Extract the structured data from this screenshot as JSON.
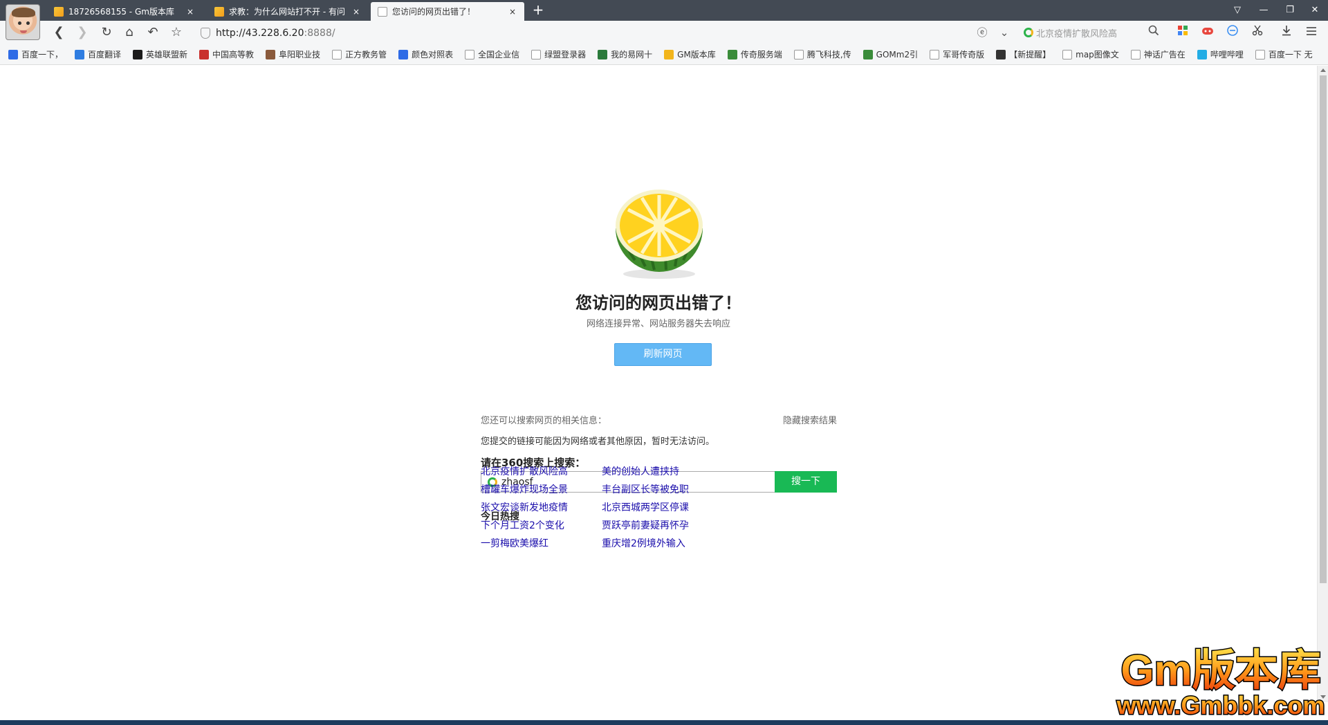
{
  "tabs": [
    {
      "title": "18726568155 - Gm版本库",
      "close": "×"
    },
    {
      "title": "求教：为什么网站打不开 - 有问",
      "close": "×"
    },
    {
      "title": "您访问的网页出错了！",
      "close": "×"
    }
  ],
  "newtab_label": "+",
  "window_controls": {
    "menu": "▽",
    "minimize": "—",
    "restore": "❐",
    "close": "✕"
  },
  "navigation": {
    "back": "❮",
    "forward": "❯",
    "reload": "↻",
    "home": "⌂",
    "undo": "↶",
    "star": "☆"
  },
  "address": {
    "host": "http://43.228.6.20",
    "rest": ":8888/"
  },
  "address_tools": {
    "compat": "ⓔ",
    "dropdown": "⌄"
  },
  "search_box": {
    "placeholder": "北京疫情扩散风险高",
    "icon": "search-icon"
  },
  "toolbar_icons": [
    "apps-icon",
    "game-icon",
    "translate-icon",
    "scissors-icon",
    "download-icon",
    "menu-icon"
  ],
  "bookmarks": [
    {
      "label": "百度一下，",
      "color": "#2e6be6"
    },
    {
      "label": "百度翻译",
      "color": "#2f7de1"
    },
    {
      "label": "英雄联盟新",
      "color": "#1b1b1b"
    },
    {
      "label": "中国高等教",
      "color": "#c9302c"
    },
    {
      "label": "阜阳职业技",
      "color": "#8a5a3c"
    },
    {
      "label": "正方教务管",
      "color": "#ffffff"
    },
    {
      "label": "颜色对照表",
      "color": "#2e6be6"
    },
    {
      "label": "全国企业信",
      "color": "#ffffff"
    },
    {
      "label": "绿盟登录器",
      "color": "#ffffff"
    },
    {
      "label": "我的易网十",
      "color": "#2a7a3b"
    },
    {
      "label": "GM版本库",
      "color": "#f2b51c"
    },
    {
      "label": "传奇服务端",
      "color": "#3a8c3a"
    },
    {
      "label": "腾飞科技,传",
      "color": "#ffffff"
    },
    {
      "label": "GOMm2引",
      "color": "#3a8c3a"
    },
    {
      "label": "军哥传奇版",
      "color": "#ffffff"
    },
    {
      "label": "【新提醒】",
      "color": "#333333"
    },
    {
      "label": "map图像文",
      "color": "#ffffff"
    },
    {
      "label": "神话广告在",
      "color": "#ffffff"
    },
    {
      "label": "哔哩哔哩",
      "color": "#23ade5"
    },
    {
      "label": "百度一下 无",
      "color": "#ffffff"
    }
  ],
  "error": {
    "title": "您访问的网页出错了！",
    "subtitle": "网络连接异常、网站服务器失去响应",
    "refresh_label": "刷新网页"
  },
  "search_section": {
    "hint": "您还可以搜索网页的相关信息：",
    "hide": "隐藏搜索结果",
    "reason": "您提交的链接可能因为网络或者其他原因，暂时无法访问。",
    "title": "请在360搜索上搜索：",
    "query": "zhaosf",
    "button": "搜一下"
  },
  "hot": {
    "title": "今日热搜",
    "col1": [
      "北京疫情扩散风险高",
      "槽罐车爆炸现场全景",
      "张文宏谈新发地疫情",
      "下个月工资2个变化",
      "一剪梅欧美爆红"
    ],
    "col2": [
      "美的创始人遭挟持",
      "丰台副区长等被免职",
      "北京西城两学区停课",
      "贾跃亭前妻疑再怀孕",
      "重庆增2例境外输入"
    ]
  },
  "watermark": {
    "line1": "Gm版本库",
    "line2": "www.Gmbbk.com"
  }
}
